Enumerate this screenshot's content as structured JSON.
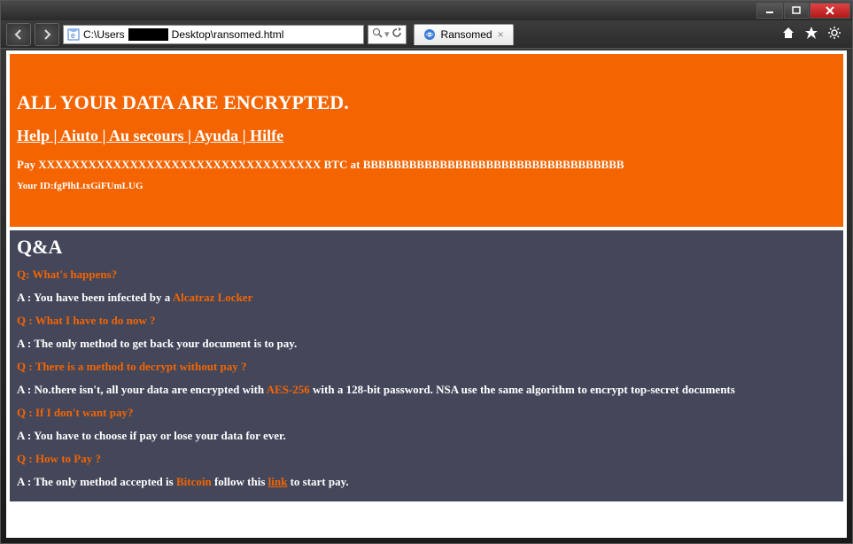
{
  "window": {
    "url_prefix": "C:\\Users",
    "url_suffix": "Desktop\\ransomed.html",
    "tab_title": "Ransomed"
  },
  "header": {
    "title": "ALL YOUR DATA ARE ENCRYPTED.",
    "help_links": [
      "Help",
      "Aiuto",
      "Au secours",
      "Ayuda",
      "Hilfe"
    ],
    "pay_prefix": "Pay ",
    "pay_amount": "XXXXXXXXXXXXXXXXXXXXXXXXXXXXXXXXXX",
    "pay_mid": " BTC at ",
    "pay_address": "BBBBBBBBBBBBBBBBBBBBBBBBBBBBBBBBBB",
    "id_prefix": "Your ID:",
    "id_value": "fgPlhLtxGiFUmLUG"
  },
  "qa": {
    "title": "Q&A",
    "items": [
      {
        "q": "Q: What's happens?",
        "a_pre": "A : You have been infected by a ",
        "a_hl": "Alcatraz Locker",
        "a_post": ""
      },
      {
        "q": "Q : What I have to do now ?",
        "a_pre": "A : The only method to get back your document is to pay.",
        "a_hl": "",
        "a_post": ""
      },
      {
        "q": "Q : There is a method to decrypt without pay ?",
        "a_pre": "A : No.there isn't, all your data are encrypted with ",
        "a_hl": "AES-256",
        "a_post": " with a 128-bit password. NSA use the same algorithm to encrypt top-secret documents"
      },
      {
        "q": "Q : If I don't want pay?",
        "a_pre": "A : You have to choose if pay or lose your data for ever.",
        "a_hl": "",
        "a_post": ""
      },
      {
        "q": "Q : How to Pay ?",
        "a_pre": "A : The only method accepted is ",
        "a_hl": "Bitcoin",
        "a_post_pre": " follow this ",
        "a_link": "link",
        "a_post": " to start pay."
      }
    ]
  }
}
